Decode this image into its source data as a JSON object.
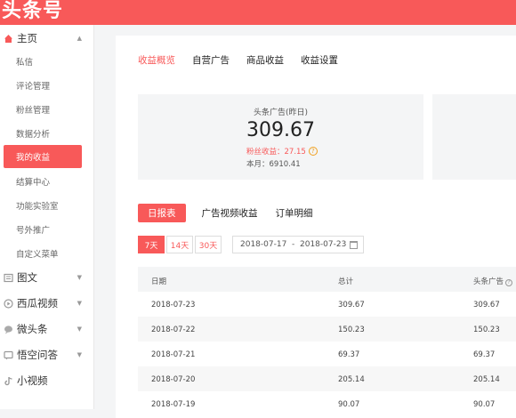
{
  "app": {
    "logo": "头条号"
  },
  "sidebar": {
    "main_group": {
      "label": "主页",
      "icon": "home-icon"
    },
    "items": [
      "私信",
      "评论管理",
      "粉丝管理",
      "数据分析",
      "我的收益",
      "结算中心",
      "功能实验室",
      "号外推广",
      "自定义菜单"
    ],
    "active_item": "我的收益",
    "groups": [
      {
        "label": "图文",
        "icon": "article-icon"
      },
      {
        "label": "西瓜视频",
        "icon": "video-icon"
      },
      {
        "label": "微头条",
        "icon": "chat-icon"
      },
      {
        "label": "悟空问答",
        "icon": "qa-icon"
      },
      {
        "label": "小视频",
        "icon": "short-video-icon"
      }
    ]
  },
  "top_tabs": [
    "收益概览",
    "自营广告",
    "商品收益",
    "收益设置"
  ],
  "top_tabs_active": "收益概览",
  "summary": {
    "title": "头条广告(昨日)",
    "value": "309.67",
    "fans_income": "粉丝收益：27.15",
    "month": "本月：6910.41"
  },
  "second_tabs": [
    "日报表",
    "广告视频收益",
    "订单明细"
  ],
  "second_tabs_active": "日报表",
  "range_buttons": [
    "7天",
    "14天",
    "30天"
  ],
  "range_active": "7天",
  "date_range": "2018-07-17  -  2018-07-23",
  "table": {
    "headers": [
      "日期",
      "总计",
      "头条广告"
    ],
    "rows": [
      [
        "2018-07-23",
        "309.67",
        "309.67"
      ],
      [
        "2018-07-22",
        "150.23",
        "150.23"
      ],
      [
        "2018-07-21",
        "69.37",
        "69.37"
      ],
      [
        "2018-07-20",
        "205.14",
        "205.14"
      ],
      [
        "2018-07-19",
        "90.07",
        "90.07"
      ]
    ]
  },
  "colors": {
    "accent": "#f85959",
    "help": "#f0a020"
  }
}
